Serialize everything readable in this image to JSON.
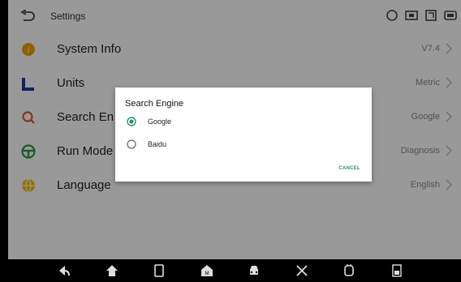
{
  "header": {
    "title": "Settings"
  },
  "settings": {
    "items": [
      {
        "label": "System Info",
        "value": "V7.4",
        "icon": "info-icon"
      },
      {
        "label": "Units",
        "value": "Metric",
        "icon": "units-icon"
      },
      {
        "label": "Search En",
        "value": "Google",
        "icon": "search-icon"
      },
      {
        "label": "Run Mode",
        "value": "Diagnosis",
        "icon": "steering-wheel-icon"
      },
      {
        "label": "Language",
        "value": "English",
        "icon": "globe-icon"
      }
    ]
  },
  "dialog": {
    "title": "Search Engine",
    "options": [
      {
        "label": "Google",
        "selected": true
      },
      {
        "label": "Baidu",
        "selected": false
      }
    ],
    "cancel_label": "CANCEL"
  },
  "colors": {
    "accent": "#2a8f6a",
    "info": "#f2a20c",
    "units": "#1a3a9c",
    "search": "#e4572e",
    "run_mode": "#2a9a4a",
    "language": "#f2c20c"
  },
  "navbar": {
    "icons": [
      "back-icon",
      "home-icon",
      "recent-apps-icon",
      "service-icon",
      "car-icon",
      "tools-icon",
      "vci-icon",
      "screenshot-icon"
    ]
  },
  "status_icons": [
    "sync-icon",
    "display-icon",
    "screen-record-icon",
    "vci-status-icon"
  ]
}
